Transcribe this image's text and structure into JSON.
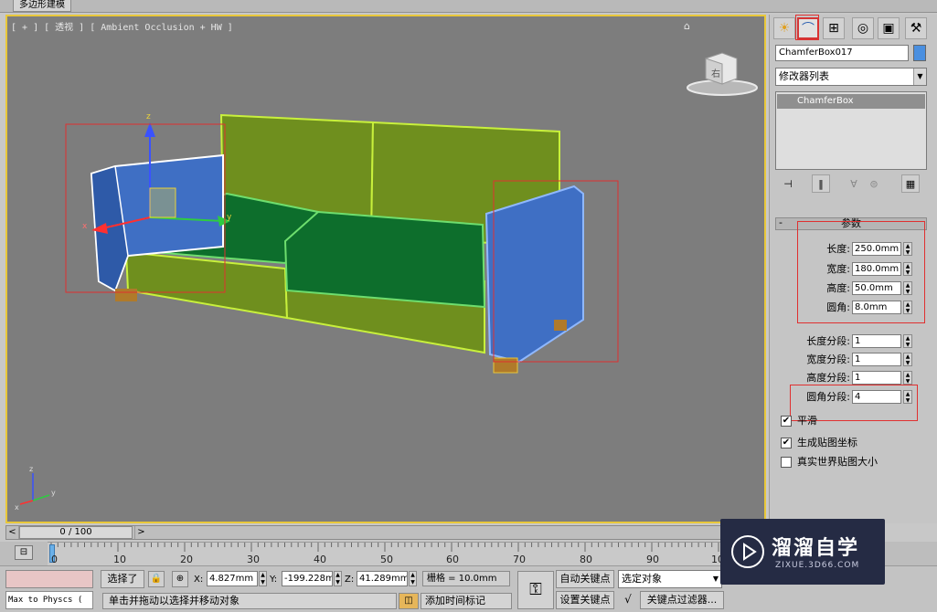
{
  "top_tab": {
    "label": "多边形建模"
  },
  "viewport": {
    "label": "[ + ] [ 透视 ] [ Ambient Occlusion + HW ]",
    "viewcube_label": "右",
    "axis_labels": {
      "x": "x",
      "y": "y",
      "z": "z"
    },
    "home_icon": "home-icon"
  },
  "command_panel": {
    "tabs": [
      {
        "name": "create-tab",
        "icon": "sun-icon"
      },
      {
        "name": "modify-tab",
        "icon": "arc-icon"
      },
      {
        "name": "hierarchy-tab",
        "icon": "hierarchy-icon"
      },
      {
        "name": "motion-tab",
        "icon": "motion-icon"
      },
      {
        "name": "display-tab",
        "icon": "display-icon"
      },
      {
        "name": "utilities-tab",
        "icon": "hammer-icon"
      }
    ],
    "object_name": "ChamferBox017",
    "object_color": "#4a8fe0",
    "modifier_list": "修改器列表",
    "stack_items": [
      "ChamferBox"
    ],
    "rollout_title": "参数",
    "params": [
      {
        "label": "长度:",
        "value": "250.0mm"
      },
      {
        "label": "宽度:",
        "value": "180.0mm"
      },
      {
        "label": "高度:",
        "value": "50.0mm"
      },
      {
        "label": "圆角:",
        "value": "8.0mm"
      }
    ],
    "segments": [
      {
        "label": "长度分段:",
        "value": "1"
      },
      {
        "label": "宽度分段:",
        "value": "1"
      },
      {
        "label": "高度分段:",
        "value": "1"
      },
      {
        "label": "圆角分段:",
        "value": "4"
      }
    ],
    "checkboxes": [
      {
        "label": "平滑",
        "checked": true
      },
      {
        "label": "生成贴图坐标",
        "checked": true
      },
      {
        "label": "真实世界贴图大小",
        "checked": false
      }
    ]
  },
  "time_slider": {
    "label": "0 / 100",
    "prev": "<",
    "next": ">"
  },
  "track_bar": {
    "ticks": [
      "0",
      "10",
      "20",
      "30",
      "40",
      "50",
      "60",
      "70",
      "80",
      "90",
      "10"
    ]
  },
  "status_bar": {
    "maxscript": "Max to Physcs (",
    "selection": "选择了",
    "x_label": "X:",
    "x_value": "4.827mm",
    "y_label": "Y:",
    "y_value": "-199.228m",
    "z_label": "Z:",
    "z_value": "41.289mm",
    "grid": "栅格 = 10.0mm",
    "prompt": "单击并拖动以选择并移动对象",
    "add_time_tag": "添加时间标记",
    "auto_key": "自动关键点",
    "set_key": "设置关键点",
    "key_selection": "选定对象",
    "key_filters": "关键点过滤器...",
    "frame_value": "0"
  },
  "watermark": {
    "title": "溜溜自学",
    "url": "ZIXUE.3D66.COM"
  },
  "colors": {
    "viewport_bg": "#7d7d7d",
    "active_border": "#e9c83a",
    "selection_blue": "#3f6fc4",
    "sofa_green": "#6f8f1e",
    "annotation_red": "#e03030"
  }
}
